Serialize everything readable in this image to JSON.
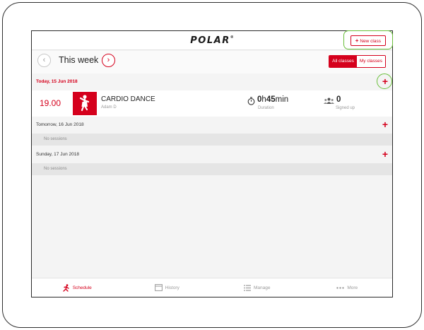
{
  "header": {
    "logo": "POLAR",
    "logo_mark": "®",
    "new_class_label": "New class"
  },
  "week": {
    "title": "This week",
    "prev_symbol": "‹",
    "next_symbol": "›",
    "filter_all": "All classes",
    "filter_mine": "My classes",
    "active_filter": "All classes"
  },
  "days": [
    {
      "date": "Today, 15 Jun 2018",
      "classes": [
        {
          "time": "19.00",
          "name": "CARDIO DANCE",
          "instructor": "Adam D",
          "duration_hours": "0",
          "duration_h_unit": "h",
          "duration_minutes": "45",
          "duration_min_unit": "min",
          "duration_label": "Duration",
          "signed_up": "0",
          "signed_up_label": "Signed up"
        }
      ]
    },
    {
      "date": "Tomorrow, 16 Jun 2018",
      "empty_label": "No sessions"
    },
    {
      "date": "Sunday, 17 Jun 2018",
      "empty_label": "No sessions"
    }
  ],
  "add_symbol": "+",
  "nav": [
    {
      "label": "Schedule",
      "icon": "runner-icon",
      "active": true
    },
    {
      "label": "History",
      "icon": "calendar-icon",
      "active": false
    },
    {
      "label": "Manage",
      "icon": "list-icon",
      "active": false
    },
    {
      "label": "More",
      "icon": "more-dots-icon",
      "active": false
    }
  ],
  "colors": {
    "brand_red": "#d5001c",
    "highlight_green": "#6abf3b"
  }
}
